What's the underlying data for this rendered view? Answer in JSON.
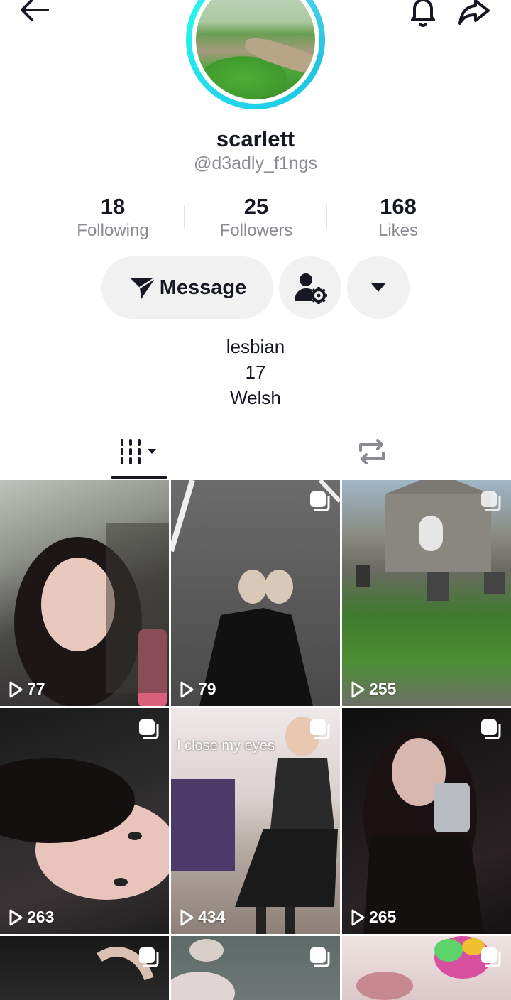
{
  "header": {
    "back_icon": "arrow-left-icon",
    "bell_icon": "bell-icon",
    "share_icon": "share-icon"
  },
  "profile": {
    "display_name": "scarlett",
    "handle": "@d3adly_f1ngs",
    "ring_color": "#20d5ec"
  },
  "stats": [
    {
      "value": "18",
      "label": "Following"
    },
    {
      "value": "25",
      "label": "Followers"
    },
    {
      "value": "168",
      "label": "Likes"
    }
  ],
  "actions": {
    "message_label": "Message",
    "message_icon": "send-icon",
    "friend_settings_icon": "person-gear-icon",
    "more_icon": "caret-down-icon"
  },
  "bio": [
    "lesbian",
    "17",
    "Welsh"
  ],
  "tabs": [
    {
      "name": "videos",
      "icon": "grid-bars-icon",
      "active": true
    },
    {
      "name": "reposts",
      "icon": "repost-icon",
      "active": false
    }
  ],
  "videos": [
    {
      "views": "77",
      "multi": false
    },
    {
      "views": "79",
      "multi": true
    },
    {
      "views": "255",
      "multi": true
    },
    {
      "views": "263",
      "multi": true
    },
    {
      "views": "434",
      "multi": true,
      "caption": "I close my eyes"
    },
    {
      "views": "265",
      "multi": true
    },
    {
      "views": "",
      "multi": true
    },
    {
      "views": "",
      "multi": true
    },
    {
      "views": "",
      "multi": true
    }
  ]
}
